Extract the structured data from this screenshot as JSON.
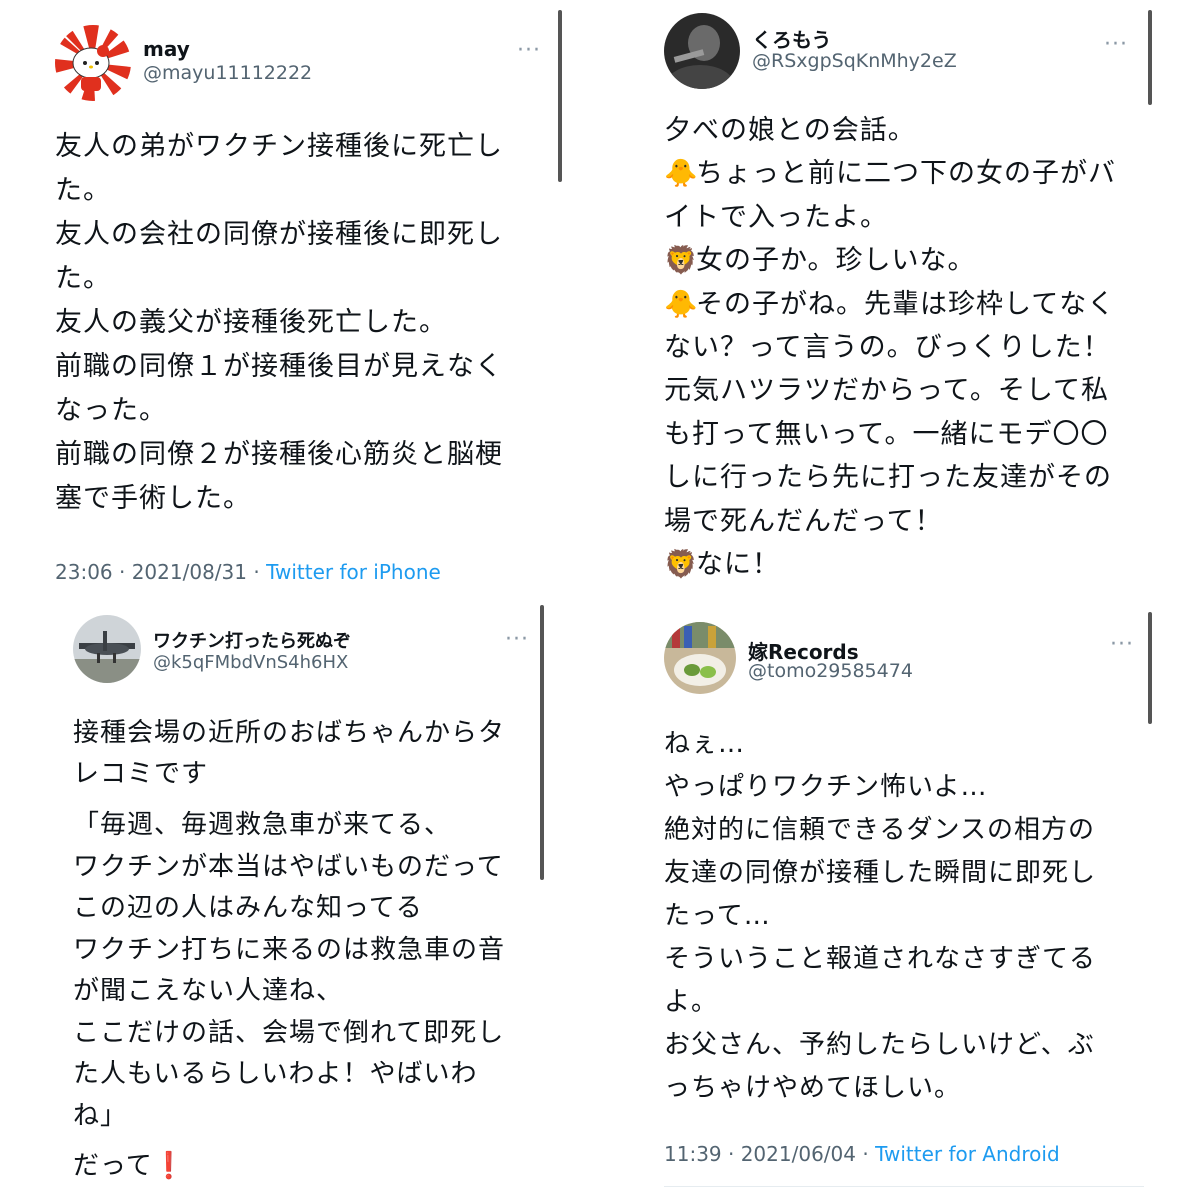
{
  "tweets": [
    {
      "name": "may",
      "handle": "@mayu11112222",
      "more": "···",
      "avatar_icon": "hello-kitty-rising-sun-avatar",
      "lines": [
        "友人の弟がワクチン接種後に死亡し",
        "た。",
        "友人の会社の同僚が接種後に即死し",
        "た。",
        "友人の義父が接種後死亡した。",
        "前職の同僚１が接種後目が見えなく",
        "なった。",
        "前職の同僚２が接種後心筋炎と脳梗",
        "塞で手術した。"
      ],
      "time": "23:06 · 2021/08/31 · ",
      "source": "Twitter for iPhone"
    },
    {
      "name": "くろもう",
      "handle": "@RSxgpSqKnMhy2eZ",
      "more": "···",
      "avatar_icon": "dark-portrait-avatar",
      "lines": [
        {
          "emoji": "",
          "text": "夕べの娘との会話。"
        },
        {
          "emoji": "🐥",
          "text": "ちょっと前に二つ下の女の子がバ"
        },
        {
          "emoji": "",
          "text": "イトで入ったよ。"
        },
        {
          "emoji": "🦁",
          "text": "女の子か。珍しいな。"
        },
        {
          "emoji": "🐥",
          "text": "その子がね。先輩は珍枠してなく"
        },
        {
          "emoji": "",
          "text": "ない？って言うの。びっくりした！"
        },
        {
          "emoji": "",
          "text": "元気ハツラツだからって。そして私"
        },
        {
          "emoji": "",
          "text": "も打って無いって。一緒にモデ〇〇"
        },
        {
          "emoji": "",
          "text": "しに行ったら先に打った友達がその"
        },
        {
          "emoji": "",
          "text": "場で死んだんだって！"
        },
        {
          "emoji": "🦁",
          "text": "なに！"
        }
      ]
    },
    {
      "name": "ワクチン打ったら死ぬぞ",
      "handle": "@k5qFMbdVnS4h6HX",
      "more": "···",
      "avatar_icon": "airplane-photo-avatar",
      "lines": [
        "接種会場の近所のおばちゃんからタ",
        "レコミです"
      ],
      "quote_lines": [
        "「毎週、毎週救急車が来てる、",
        "ワクチンが本当はやばいものだって",
        "この辺の人はみんな知ってる",
        "ワクチン打ちに来るのは救急車の音",
        "が聞こえない人達ね、",
        "ここだけの話、会場で倒れて即死し",
        "た人もいるらしいわよ！やばいわ",
        "ね」"
      ],
      "closing": "だって",
      "closing_emoji": "❗"
    },
    {
      "name": "嫁Records",
      "handle": "@tomo29585474",
      "more": "···",
      "avatar_icon": "food-photo-avatar",
      "lines": [
        "ねぇ…",
        "やっぱりワクチン怖いよ…",
        "絶対的に信頼できるダンスの相方の",
        "友達の同僚が接種した瞬間に即死し",
        "たって…",
        "そういうこと報道されなさすぎてる",
        "よ。",
        "お父さん、予約したらしいけど、ぶ",
        "っちゃけやめてほしい。"
      ],
      "time": "11:39 · 2021/06/04 · ",
      "source": "Twitter for Android"
    }
  ]
}
